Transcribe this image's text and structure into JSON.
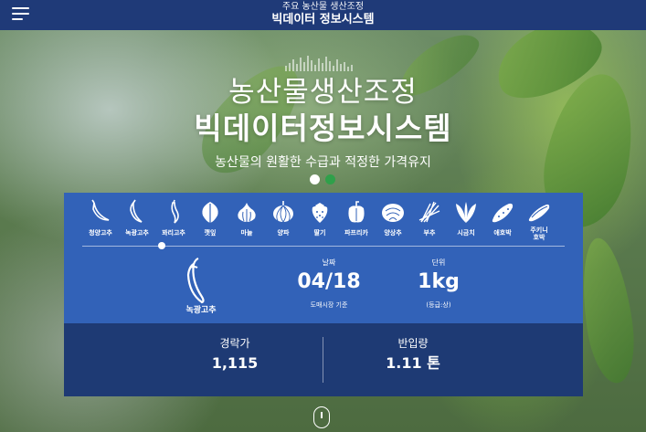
{
  "header": {
    "subtitle": "주요 농산물 생산조정",
    "title": "빅데이터 정보시스템"
  },
  "hero": {
    "title_line1": "농산물생산조정",
    "title_line2": "빅데이터정보시스템",
    "tagline": "농산물의 원활한 수급과 적정한 가격유지"
  },
  "carousel": {
    "active_index": 0,
    "count": 2,
    "active_color": "#ffffff",
    "inactive_color": "#2fa04a"
  },
  "vegetables": [
    {
      "label": "청양고추",
      "icon": "chili-icon"
    },
    {
      "label": "녹광고추",
      "icon": "green-pepper-icon"
    },
    {
      "label": "꽈리고추",
      "icon": "shishito-icon"
    },
    {
      "label": "깻잎",
      "icon": "perilla-leaf-icon"
    },
    {
      "label": "마늘",
      "icon": "garlic-icon"
    },
    {
      "label": "양파",
      "icon": "onion-icon"
    },
    {
      "label": "딸기",
      "icon": "strawberry-icon"
    },
    {
      "label": "파프리카",
      "icon": "paprika-icon"
    },
    {
      "label": "양상추",
      "icon": "lettuce-icon"
    },
    {
      "label": "부추",
      "icon": "chives-icon"
    },
    {
      "label": "시금치",
      "icon": "spinach-icon"
    },
    {
      "label": "애호박",
      "icon": "zucchini-icon"
    },
    {
      "label": "주키니호박",
      "label_line1": "주키니",
      "label_line2": "호박",
      "icon": "zucchini-squash-icon"
    }
  ],
  "selected": {
    "index": 2,
    "name": "녹광고추",
    "date_label": "날짜",
    "date": "04/18",
    "date_note": "도매시장 기준",
    "unit_label": "단위",
    "unit": "1kg",
    "unit_note": "(등급:상)"
  },
  "stats": {
    "auction_label": "경락가",
    "auction_value": "1,115",
    "import_label": "반입량",
    "import_value": "1.11 톤"
  },
  "colors": {
    "topbar": "#1f3a78",
    "panel_top": "#3262b8",
    "panel_bottom": "#1e3a74"
  }
}
